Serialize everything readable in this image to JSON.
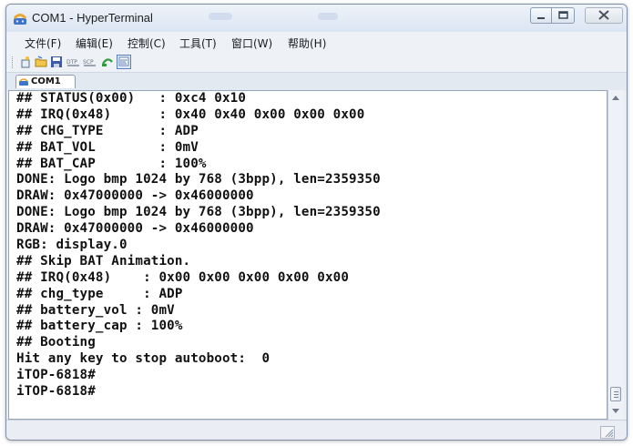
{
  "window": {
    "title": "COM1 - HyperTerminal",
    "icons": {
      "app": "hyperterminal-phone-icon",
      "minimize": "minimize-icon",
      "maximize": "maximize-icon",
      "close": "close-icon"
    }
  },
  "menu": {
    "items": [
      "文件(F)",
      "编辑(E)",
      "控制(C)",
      "工具(T)",
      "窗口(W)",
      "帮助(H)"
    ]
  },
  "toolbar": {
    "icons": [
      "new-icon",
      "open-icon",
      "save-icon",
      "dtp-icon",
      "scp-icon",
      "disconnect-icon",
      "properties-icon"
    ]
  },
  "tabs": [
    {
      "label": "COM1",
      "icon": "connection-icon"
    }
  ],
  "terminal": {
    "lines": [
      "## STATUS(0x00)   : 0xc4 0x10",
      "## IRQ(0x48)      : 0x40 0x40 0x00 0x00 0x00",
      "## CHG_TYPE       : ADP",
      "## BAT_VOL        : 0mV",
      "## BAT_CAP        : 100%",
      "DONE: Logo bmp 1024 by 768 (3bpp), len=2359350",
      "DRAW: 0x47000000 -> 0x46000000",
      "DONE: Logo bmp 1024 by 768 (3bpp), len=2359350",
      "DRAW: 0x47000000 -> 0x46000000",
      "RGB: display.0",
      "## Skip BAT Animation.",
      "## IRQ(0x48)    : 0x00 0x00 0x00 0x00 0x00",
      "## chg_type     : ADP",
      "## battery_vol : 0mV",
      "## battery_cap : 100%",
      "## Booting",
      "Hit any key to stop autoboot:  0",
      "iTOP-6818#",
      "iTOP-6818#"
    ]
  },
  "colors": {
    "titlebar": "#dbe5f2",
    "terminal_bg": "#ffffff",
    "terminal_text": "#111111"
  }
}
